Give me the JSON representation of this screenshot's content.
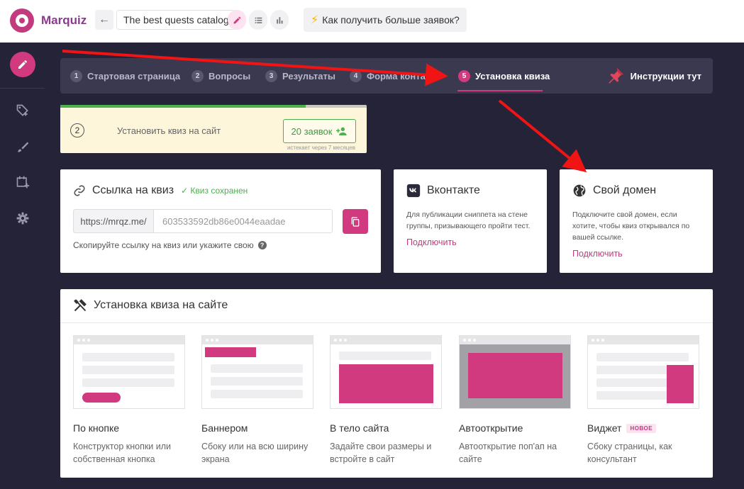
{
  "colors": {
    "accent": "#d13a7f",
    "sidebar": "#252338",
    "success": "#4caf50",
    "arrow": "#f01414"
  },
  "header": {
    "logo_text": "Marquiz",
    "quiz_name": "The best quests catalog",
    "help_label": "Как получить больше заявок?",
    "icons": [
      "back-arrow-icon",
      "pencil-icon",
      "list-icon",
      "bar-chart-icon",
      "lightning-icon"
    ]
  },
  "sidebar": {
    "icons": [
      "pencil-icon",
      "tag-plus-icon",
      "brush-icon",
      "calendar-plus-icon",
      "gear-icon"
    ]
  },
  "tabs": {
    "items": [
      {
        "num": "1",
        "label": "Стартовая страница"
      },
      {
        "num": "2",
        "label": "Вопросы"
      },
      {
        "num": "3",
        "label": "Результаты"
      },
      {
        "num": "4",
        "label": "Форма контакто"
      },
      {
        "num": "5",
        "label": "Установка квиза"
      }
    ],
    "active": 4,
    "instructions_label": "Инструкции тут"
  },
  "progress": {
    "step": "2",
    "text": "Установить квиз на сайт",
    "leads_label": "20 заявок",
    "expire_text": "истекает через 7 месяцев",
    "fill_percent": 80
  },
  "link_card": {
    "title": "Ссылка на квиз",
    "saved_label": "✓ Квиз сохранен",
    "url_prefix": "https://mrqz.me/",
    "url_value": "603533592db86e0044eaadae",
    "hint": "Скопируйте ссылку на квиз или укажите свою",
    "hint_icon": "?"
  },
  "vk_card": {
    "title": "Вконтакте",
    "description": "Для публикации сниппета на стене группы, призывающего пройти тест.",
    "connect_label": "Подключить"
  },
  "domain_card": {
    "title": "Свой домен",
    "description": "Подключите свой домен, если хотите, чтобы квиз открывался по вашей ссылке.",
    "connect_label": "Подключить"
  },
  "install": {
    "title": "Установка квиза на сайте",
    "options": [
      {
        "title": "По кнопке",
        "desc": "Конструктор кнопки или собственная кнопка",
        "badge": ""
      },
      {
        "title": "Баннером",
        "desc": "Сбоку или на всю ширину экрана",
        "badge": ""
      },
      {
        "title": "В тело сайта",
        "desc": "Задайте свои размеры и встройте в сайт",
        "badge": ""
      },
      {
        "title": "Автооткрытие",
        "desc": "Автооткрытие поп'ап на сайте",
        "badge": ""
      },
      {
        "title": "Виджет",
        "desc": "Сбоку страницы, как консультант",
        "badge": "НОВОЕ"
      }
    ]
  }
}
